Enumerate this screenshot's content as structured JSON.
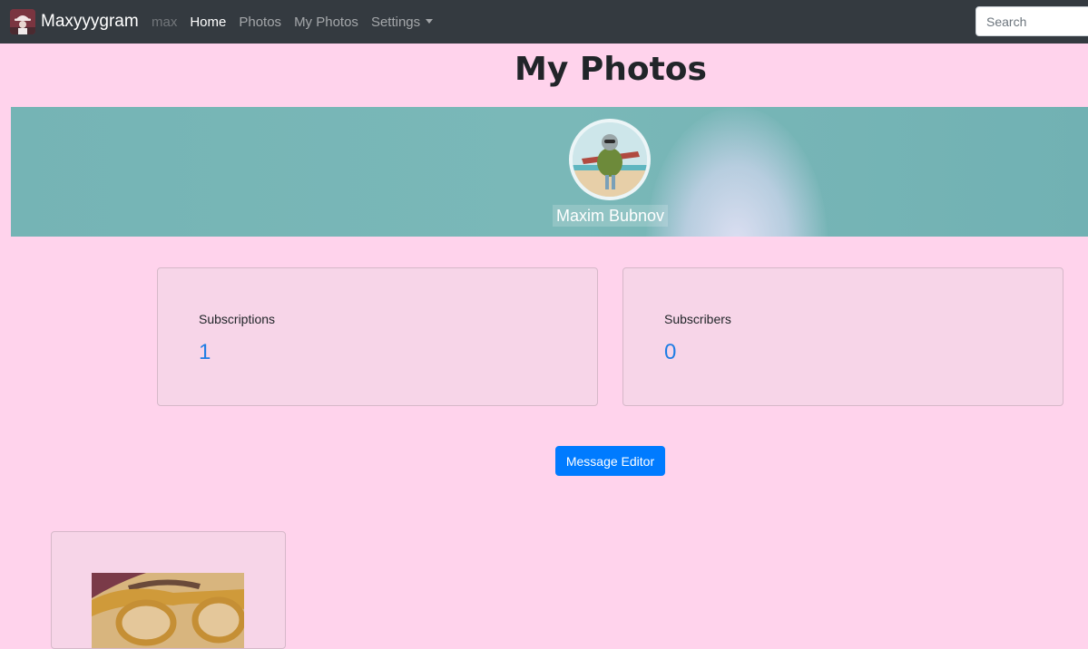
{
  "navbar": {
    "brand": "Maxyyygram",
    "user": "max",
    "links": [
      "Home",
      "Photos",
      "My Photos",
      "Settings"
    ],
    "search_placeholder": "Search"
  },
  "page": {
    "title": "My Photos"
  },
  "profile": {
    "name": "Maxim Bubnov"
  },
  "stats": [
    {
      "label": "Subscriptions",
      "value": "1"
    },
    {
      "label": "Subscribers",
      "value": "0"
    }
  ],
  "actions": {
    "message_editor": "Message Editor"
  },
  "colors": {
    "background": "#ffd3ec",
    "navbar": "#343a40",
    "accent": "#007bff",
    "stat_value": "#1f7de4"
  },
  "icons": {
    "settings_dropdown": "caret-down-icon"
  }
}
